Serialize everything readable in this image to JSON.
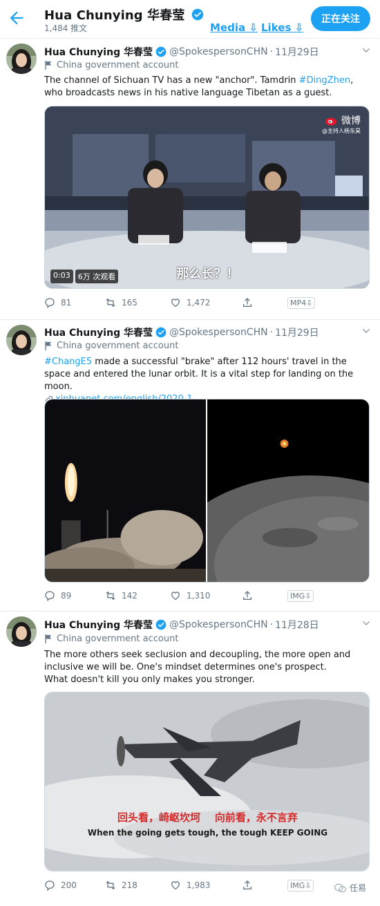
{
  "header": {
    "name": "Hua Chunying 华春莹",
    "tweet_count": "1,484 推文",
    "media_tab": "Media ⇩",
    "likes_tab": "Likes ⇩",
    "follow_label": "正在关注"
  },
  "tweets": [
    {
      "name": "Hua Chunying 华春莹",
      "handle": "@SpokespersonCHN",
      "date": "11月29日",
      "gov_label": "China government account",
      "text_a": "The channel of Sichuan TV has a new \"anchor\". Tamdrin ",
      "link_a": "#DingZhen",
      "text_b": ", who broadcasts news in his native language Tibetan as a guest.",
      "video_time": "0:03",
      "video_views": "6万 次观看",
      "weibo_label": "微博",
      "weibo_sub": "@主持人杨东昊",
      "subtitle": "那么长？！",
      "replies": "81",
      "retweets": "165",
      "likes": "1,472",
      "badge": "MP4⇩"
    },
    {
      "name": "Hua Chunying 华春莹",
      "handle": "@SpokespersonCHN",
      "date": "11月29日",
      "gov_label": "China government account",
      "link_a": "#ChangE5",
      "text_b": " made a successful \"brake\" after 112 hours' travel in the space and entered the lunar orbit. It is a vital step for landing on the moon.",
      "url": "xinhuanet.com/english/2020-1…",
      "replies": "89",
      "retweets": "142",
      "likes": "1,310",
      "badge": "IMG⇩"
    },
    {
      "name": "Hua Chunying 华春莹",
      "handle": "@SpokespersonCHN",
      "date": "11月28日",
      "gov_label": "China government account",
      "text_a": "The more others seek seclusion and decoupling, the more open and inclusive we will be. One's mindset determines one's prospect.",
      "text_b": "What doesn't kill you only makes you stronger.",
      "caption_cn": "回头看，崎岖坎坷    向前看，永不言弃",
      "caption_en": "When the going gets tough, the tough KEEP GOING",
      "replies": "200",
      "retweets": "218",
      "likes": "1,983",
      "badge": "IMG⇩"
    }
  ],
  "watermark": "任易",
  "colors": {
    "accent": "#1da1f2",
    "muted": "#657786",
    "text": "#14171a",
    "border": "#e6ecf0",
    "caption_red": "#d42a2a"
  }
}
